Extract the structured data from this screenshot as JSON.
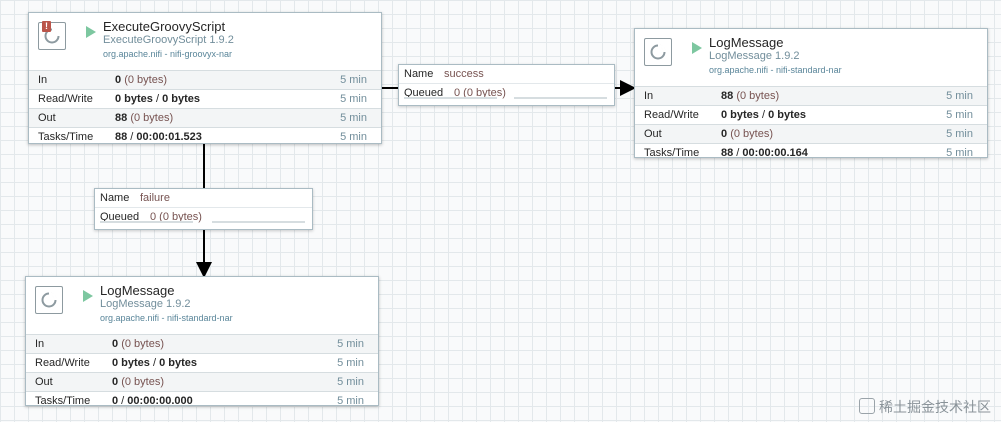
{
  "processors": [
    {
      "id": "execute-groovy",
      "name": "ExecuteGroovyScript",
      "type": "ExecuteGroovyScript 1.9.2",
      "bundle": "org.apache.nifi - nifi-groovyx-nar",
      "has_warning": true,
      "rows": [
        {
          "label": "In",
          "count": "0",
          "detail": "(0 bytes)",
          "duration": "5 min"
        },
        {
          "label": "Read/Write",
          "count": "0 bytes",
          "sep": " / ",
          "count2": "0 bytes",
          "duration": "5 min"
        },
        {
          "label": "Out",
          "count": "88",
          "detail": "(0 bytes)",
          "duration": "5 min"
        },
        {
          "label": "Tasks/Time",
          "count": "88",
          "sep": " / ",
          "count2": "00:00:01.523",
          "duration": "5 min"
        }
      ]
    },
    {
      "id": "log-success",
      "name": "LogMessage",
      "type": "LogMessage 1.9.2",
      "bundle": "org.apache.nifi - nifi-standard-nar",
      "rows": [
        {
          "label": "In",
          "count": "88",
          "detail": "(0 bytes)",
          "duration": "5 min"
        },
        {
          "label": "Read/Write",
          "count": "0 bytes",
          "sep": " / ",
          "count2": "0 bytes",
          "duration": "5 min"
        },
        {
          "label": "Out",
          "count": "0",
          "detail": "(0 bytes)",
          "duration": "5 min"
        },
        {
          "label": "Tasks/Time",
          "count": "88",
          "sep": " / ",
          "count2": "00:00:00.164",
          "duration": "5 min"
        }
      ]
    },
    {
      "id": "log-failure",
      "name": "LogMessage",
      "type": "LogMessage 1.9.2",
      "bundle": "org.apache.nifi - nifi-standard-nar",
      "rows": [
        {
          "label": "In",
          "count": "0",
          "detail": "(0 bytes)",
          "duration": "5 min"
        },
        {
          "label": "Read/Write",
          "count": "0 bytes",
          "sep": " / ",
          "count2": "0 bytes",
          "duration": "5 min"
        },
        {
          "label": "Out",
          "count": "0",
          "detail": "(0 bytes)",
          "duration": "5 min"
        },
        {
          "label": "Tasks/Time",
          "count": "0",
          "sep": " / ",
          "count2": "00:00:00.000",
          "duration": "5 min"
        }
      ]
    }
  ],
  "connections": {
    "success": {
      "name_label": "Name",
      "name": "success",
      "queued_label": "Queued",
      "queued": "0 (0 bytes)"
    },
    "failure": {
      "name_label": "Name",
      "name": "failure",
      "queued_label": "Queued",
      "queued": "0 (0 bytes)"
    }
  },
  "watermark": "稀土掘金技术社区",
  "colors": {
    "canvas": "#f9fafb",
    "grid": "#e3e8eb",
    "run_indicator": "#7dc7a0",
    "warning_badge": "#ba554a",
    "type_text": "#728e9b"
  }
}
